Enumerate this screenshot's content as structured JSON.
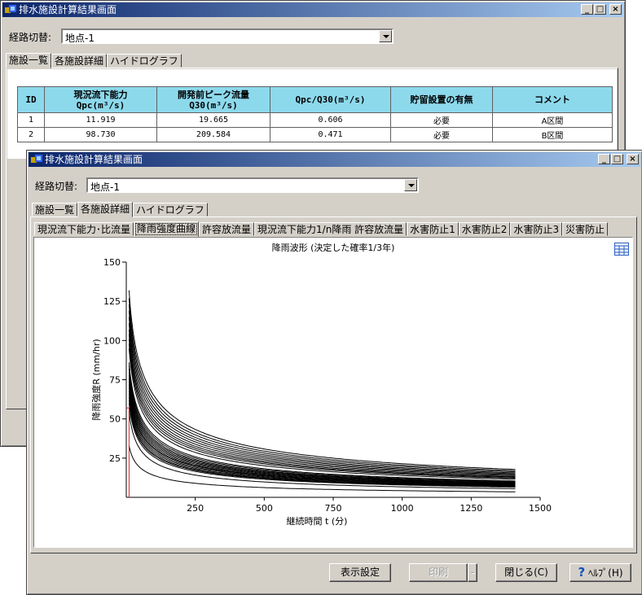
{
  "back_window": {
    "title": "排水施設計算結果画面",
    "route_label": "経路切替:",
    "route_value": "地点-1",
    "tabs": [
      "施設一覧",
      "各施設詳細",
      "ハイドログラフ"
    ],
    "table": {
      "headers": [
        "ID",
        "現況流下能力\nQpc(m³/s)",
        "開発前ピーク流量\nQ30(m³/s)",
        "Qpc/Q30(m³/s)",
        "貯留設置の有無",
        "コメント"
      ],
      "rows": [
        [
          "1",
          "11.919",
          "19.665",
          "0.606",
          "必要",
          "A区間"
        ],
        [
          "2",
          "98.730",
          "209.584",
          "0.471",
          "必要",
          "B区間"
        ]
      ]
    }
  },
  "front_window": {
    "title": "排水施設計算結果画面",
    "route_label": "経路切替:",
    "route_value": "地点-1",
    "tabs": [
      "施設一覧",
      "各施設詳細",
      "ハイドログラフ"
    ],
    "subtabs": [
      "現況流下能力･比流量",
      "降雨強度曲線",
      "許容放流量",
      "現況流下能力1/n降雨 許容放流量",
      "水害防止1",
      "水害防止2",
      "水害防止3",
      "災害防止"
    ],
    "active_subtab": "降雨強度曲線",
    "buttons": {
      "display_settings": "表示設定",
      "print": "印刷",
      "close": "閉じる(C)",
      "help": "ﾍﾙﾌﾟ(H)"
    }
  },
  "colors": {
    "title_start": "#0a246a",
    "title_end": "#a6caf0",
    "header_bg": "#8dd9ec",
    "marker_line": "#cc2222"
  },
  "chart_data": {
    "type": "line",
    "title": "降雨波形 (決定した確率1/3年)",
    "xlabel": "継続時間 t (分)",
    "ylabel": "降雨強度R (mm/hr)",
    "xlim": [
      0,
      1500
    ],
    "ylim": [
      0,
      150
    ],
    "xticks": [
      250,
      500,
      750,
      1000,
      1250,
      1500
    ],
    "yticks": [
      25,
      50,
      75,
      100,
      125,
      150
    ],
    "x_start": 10,
    "x_end": 1410,
    "curve_family": "R = a / (t^n + b)",
    "series_initial_values": [
      132,
      127,
      123,
      119,
      115,
      111,
      107,
      104,
      101,
      98,
      95,
      86,
      84,
      82,
      80,
      78,
      76,
      74,
      72,
      70,
      68,
      66,
      64,
      62,
      60,
      55,
      33
    ],
    "series_final_values": [
      17.8,
      17.0,
      16.3,
      15.6,
      15.0,
      14.4,
      13.8,
      13.2,
      12.7,
      12.2,
      11.5,
      10.4,
      10.0,
      9.6,
      9.3,
      9.0,
      8.7,
      8.4,
      8.1,
      7.9,
      7.6,
      7.3,
      7.0,
      6.8,
      6.5,
      5.5,
      3.5
    ],
    "marker": {
      "t": 10,
      "R": 57
    },
    "grid": false
  }
}
